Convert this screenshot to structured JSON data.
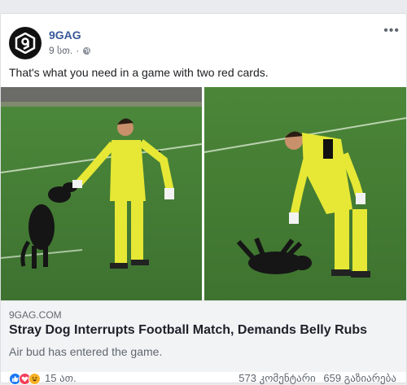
{
  "post": {
    "page_name": "9GAG",
    "time": "9 სთ.",
    "caption": "That's what you need in a game with two red cards.",
    "avatar_icon": "9gag-logo-icon",
    "audience_icon": "globe-icon"
  },
  "link_preview": {
    "domain": "9GAG.COM",
    "title": "Stray Dog Interrupts Football Match, Demands Belly Rubs",
    "description": "Air bud has entered the game."
  },
  "footer": {
    "reaction_count": "15 ათ.",
    "comments": "573 კომენტარი",
    "shares": "659 გაზიარება",
    "reaction_icons": [
      "like-icon",
      "love-icon",
      "haha-icon"
    ]
  },
  "colors": {
    "pitch": "#3f7a32",
    "keeper_kit": "#e6e835",
    "link_blue": "#385898"
  }
}
